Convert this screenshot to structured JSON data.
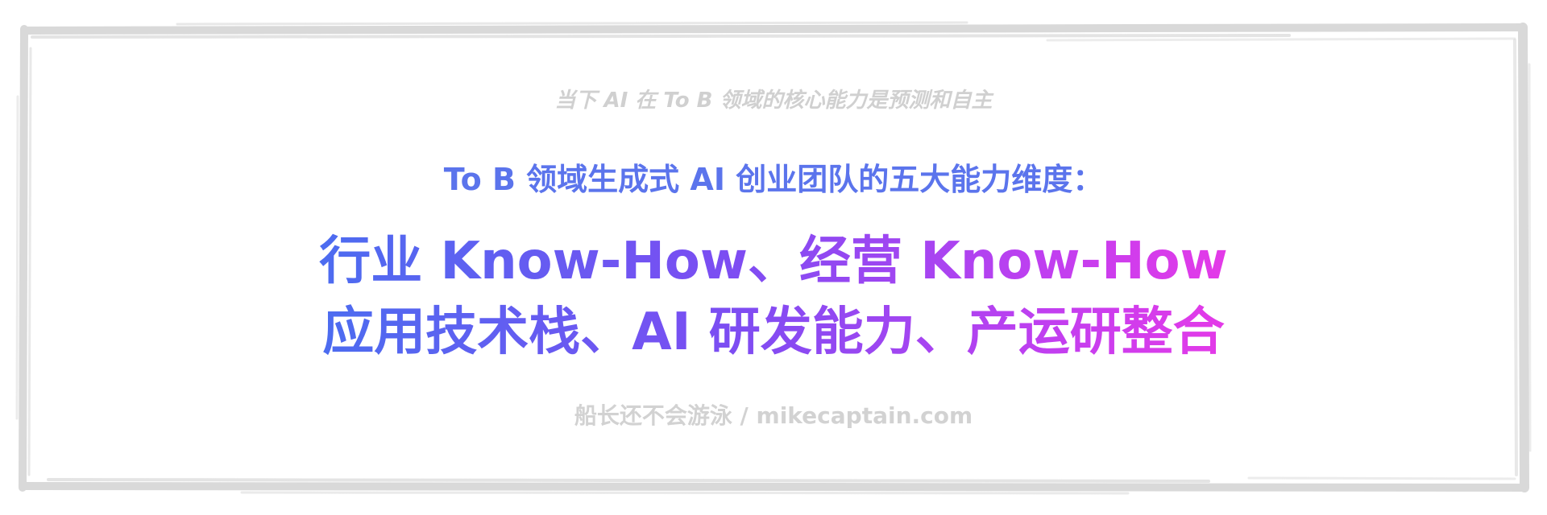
{
  "top_caption": "当下 AI 在 To B 领域的核心能力是预测和自主",
  "subtitle": "To B 领域生成式 AI 创业团队的五大能力维度：",
  "headline": {
    "line1": "行业 Know-How、经营 Know-How",
    "line2": "应用技术栈、AI 研发能力、产运研整合"
  },
  "footer": "船长还不会游泳 / mikecaptain.com",
  "colors": {
    "frame": "#d9d9d9",
    "caption": "#d0d0d0",
    "subtitle": "#5b74ec",
    "gradient_start": "#4c6cf0",
    "gradient_end": "#e43ae8",
    "footer": "#d2d2d2"
  }
}
